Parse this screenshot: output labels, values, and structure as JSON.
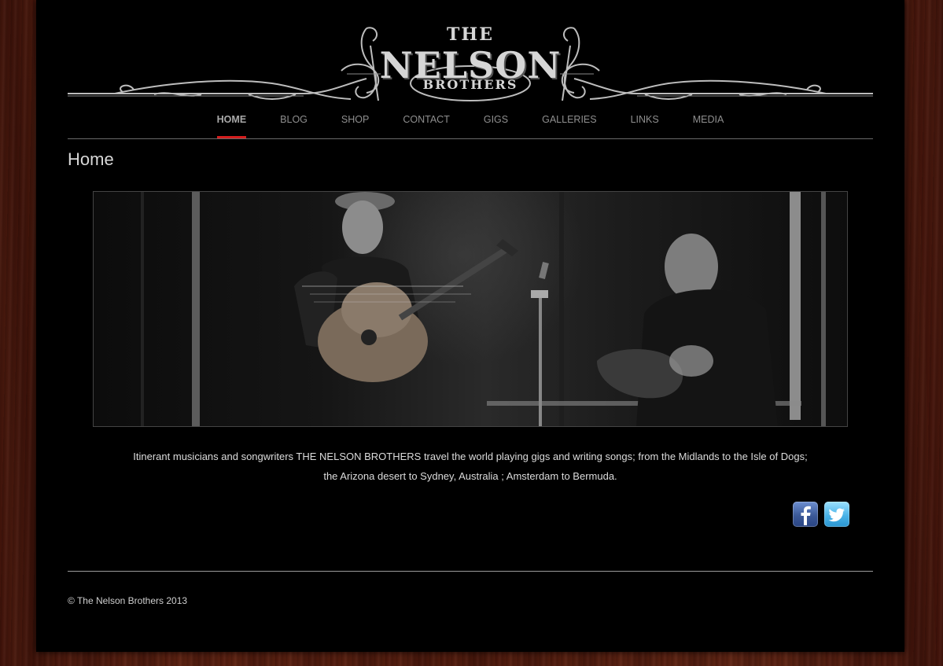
{
  "brand": {
    "line1": "THE",
    "line2": "NELSON",
    "line3": "BROTHERS"
  },
  "nav": {
    "items": [
      {
        "label": "HOME",
        "active": true
      },
      {
        "label": "BLOG"
      },
      {
        "label": "SHOP"
      },
      {
        "label": "CONTACT"
      },
      {
        "label": "GIGS"
      },
      {
        "label": "GALLERIES"
      },
      {
        "label": "LINKS"
      },
      {
        "label": "MEDIA"
      }
    ]
  },
  "page": {
    "title": "Home"
  },
  "intro": {
    "line1": "Itinerant musicians and songwriters THE NELSON BROTHERS travel the world playing gigs and writing songs; from the Midlands to the Isle of Dogs;",
    "line2": "the Arizona desert to Sydney, Australia ; Amsterdam to Bermuda."
  },
  "social": {
    "facebook_icon": "facebook-icon",
    "twitter_icon": "twitter-icon"
  },
  "footer": {
    "copyright": "© The Nelson Brothers 2013"
  },
  "colors": {
    "accent": "#d41d1d",
    "page_bg": "#000000",
    "wood": "#4a1a0d"
  }
}
